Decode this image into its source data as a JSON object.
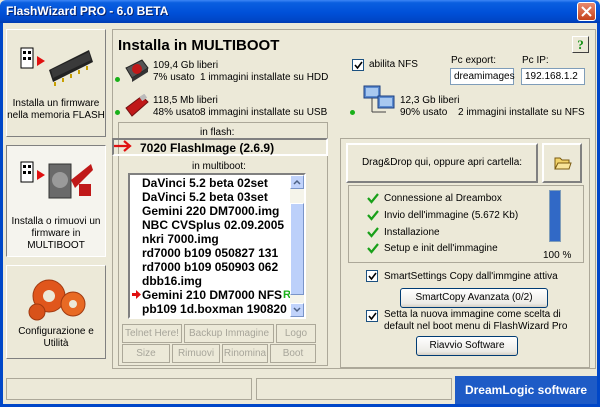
{
  "window": {
    "title": "FlashWizard PRO - 6.0 BETA"
  },
  "sidebar": {
    "items": [
      {
        "label": "Installa un firmware nella memoria FLASH"
      },
      {
        "label": "Installa o rimuovi un firmware in MULTIBOOT"
      },
      {
        "label": "Configurazione e Utilità"
      }
    ]
  },
  "main": {
    "title": "Installa in MULTIBOOT",
    "help": "?",
    "hdd": {
      "free": "109,4 Gb liberi",
      "used": "7% usato",
      "info": "1 immagini installate su HDD"
    },
    "usb": {
      "free": "118,5 Mb liberi",
      "used": "48% usato",
      "info": "8 immagini installate su USB"
    },
    "nfs": {
      "checkbox_label": "abilita NFS",
      "checked": true,
      "export_label": "Pc export:",
      "export_value": "dreamimages",
      "ip_label": "Pc IP:",
      "ip_value": "192.168.1.2",
      "free": "12,3 Gb liberi",
      "used": "90% usato",
      "info": "2 immagini installate su NFS"
    },
    "in_flash_label": "in flash:",
    "flash_image": "7020 FlashImage (2.6.9)",
    "in_multiboot_label": "in multiboot:",
    "multiboot_items": [
      "DaVinci 5.2 beta 02set",
      "DaVinci 5.2 beta 03set",
      "Gemini 220 DM7000.img",
      "NBC CVSplus 02.09.2005",
      "nkri 7000.img",
      "rd7000 b109 050827 131",
      "rd7000 b109 050903 062",
      "dbb16.img",
      "Gemini 210 DM7000 NFS",
      "pb109 1d.boxman 190820"
    ],
    "active_item_badge": "R",
    "buttons": {
      "telnet": "Telnet Here!",
      "backup": "Backup Immagine",
      "logo": "Logo",
      "size": "Size",
      "remove": "Rimuovi",
      "rename": "Rinomina",
      "boot": "Boot"
    }
  },
  "right": {
    "drag_label": "Drag&Drop qui, oppure apri cartella:",
    "steps": [
      "Connessione al Dreambox",
      "Invio dell'immagine (5.672 Kb)",
      "Installazione",
      "Setup e init dell'immagine"
    ],
    "progress_label": "100 %",
    "progress_value": 1.0,
    "smartsettings_label": "SmartSettings Copy dall'immgine attiva",
    "smartsettings_checked": true,
    "smartcopy_button": "SmartCopy Avanzata (0/2)",
    "default_boot_label": "Setta la nuova immagine come scelta di default nel boot menu di FlashWizard Pro",
    "default_boot_checked": true,
    "restart_button": "Riavvio Software"
  },
  "footer": {
    "brand": "DreamLogic software"
  },
  "colors": {
    "titlebar": "#0050d8",
    "accent_green": "#19b019",
    "brand_bg": "#1e5bc6",
    "arrow_red": "#e01010"
  }
}
